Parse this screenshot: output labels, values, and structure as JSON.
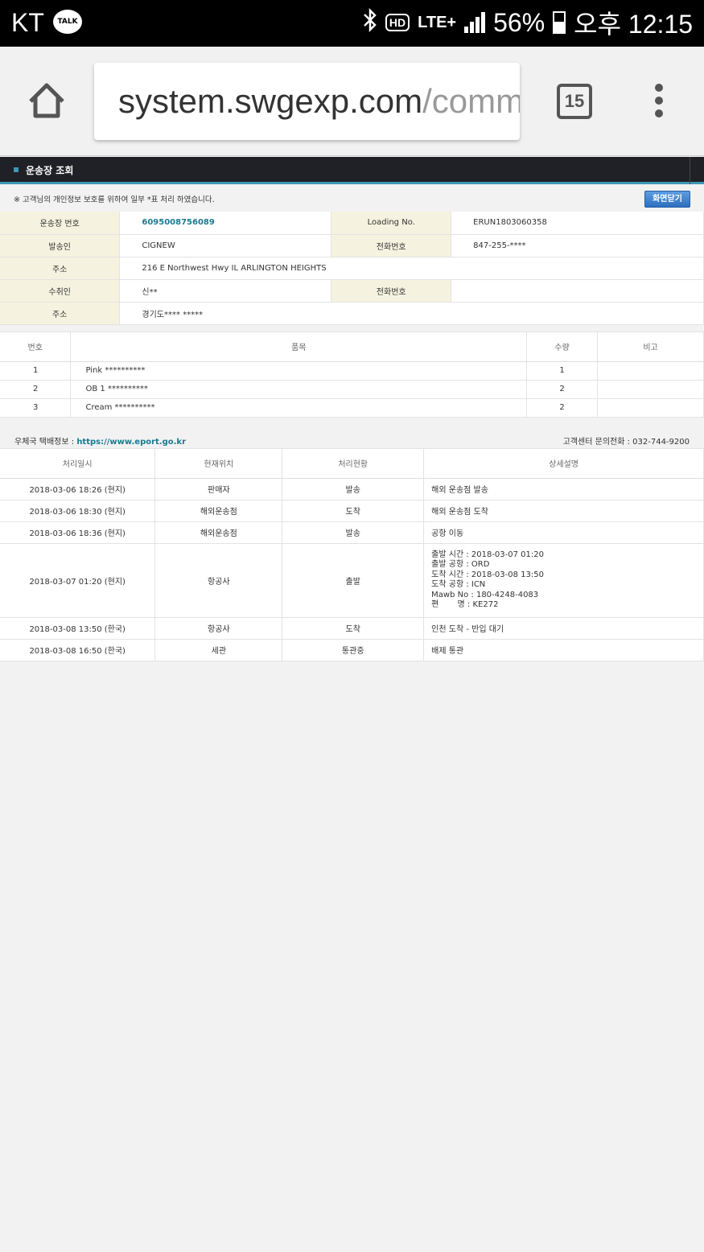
{
  "status_bar": {
    "carrier": "KT",
    "talk_label": "TALK",
    "hd_label": "HD",
    "network": "LTE+",
    "battery_percent": "56%",
    "time": "오후 12:15",
    "icons": [
      "kakaotalk-icon",
      "bluetooth-icon",
      "hd-voice-icon",
      "lte-icon",
      "signal-icon",
      "battery-icon"
    ]
  },
  "browser": {
    "url_host": "system.swgexp.com",
    "url_path": "/comm",
    "tab_count": "15",
    "icons": [
      "home-icon",
      "tabs-icon",
      "more-vert-icon"
    ]
  },
  "page": {
    "title": "운송장 조회",
    "notice": "※ 고객님의 개인정보 보호를 위하여 일부 *표 처리 하였습니다.",
    "close_button": "화면닫기",
    "info": {
      "waybill_label": "운송장 번호",
      "waybill_value": "6095008756089",
      "loading_label": "Loading No.",
      "loading_value": "ERUN1803060358",
      "sender_label": "발송인",
      "sender_value": "CIGNEW",
      "sender_phone_label": "전화번호",
      "sender_phone_value": "847-255-****",
      "sender_addr_label": "주소",
      "sender_addr_value": "216 E Northwest Hwy IL ARLINGTON HEIGHTS",
      "receiver_label": "수취인",
      "receiver_value": "신**",
      "receiver_phone_label": "전화번호",
      "receiver_phone_value": "",
      "receiver_addr_label": "주소",
      "receiver_addr_value": "경기도**** *****"
    },
    "items": {
      "headers": [
        "번호",
        "품목",
        "수량",
        "비고"
      ],
      "rows": [
        {
          "no": "1",
          "name": "Pink **********",
          "qty": "1",
          "note": ""
        },
        {
          "no": "2",
          "name": "OB 1 **********",
          "qty": "2",
          "note": ""
        },
        {
          "no": "3",
          "name": "Cream **********",
          "qty": "2",
          "note": ""
        }
      ]
    },
    "post_info_label": "우체국 택배정보 : ",
    "post_info_link": "https://www.eport.go.kr",
    "customer_center": "고객센터 문의전화 : 032-744-9200",
    "tracking": {
      "headers": [
        "처리일시",
        "현재위치",
        "처리현황",
        "상세설명"
      ],
      "rows": [
        {
          "datetime": "2018-03-06 18:26 (현지)",
          "location": "판매자",
          "status": "발송",
          "detail": [
            "해외 운송점 발송"
          ]
        },
        {
          "datetime": "2018-03-06 18:30 (현지)",
          "location": "해외운송점",
          "status": "도착",
          "detail": [
            "해외 운송점 도착"
          ]
        },
        {
          "datetime": "2018-03-06 18:36 (현지)",
          "location": "해외운송점",
          "status": "발송",
          "detail": [
            "공항 이동"
          ]
        },
        {
          "datetime": "2018-03-07 01:20 (현지)",
          "location": "항공사",
          "status": "출발",
          "detail": [
            "출발 시간 : 2018-03-07 01:20",
            "출발 공항 : ORD",
            "도착 시간 : 2018-03-08 13:50",
            "도착 공항 : ICN",
            "Mawb No : 180-4248-4083",
            "편 　　명 : KE272"
          ]
        },
        {
          "datetime": "2018-03-08 13:50 (한국)",
          "location": "항공사",
          "status": "도착",
          "detail": [
            "인천 도착 - 반입 대기"
          ]
        },
        {
          "datetime": "2018-03-08 16:50 (한국)",
          "location": "세관",
          "status": "통관중",
          "detail": [
            "배제 통관"
          ]
        }
      ]
    }
  }
}
